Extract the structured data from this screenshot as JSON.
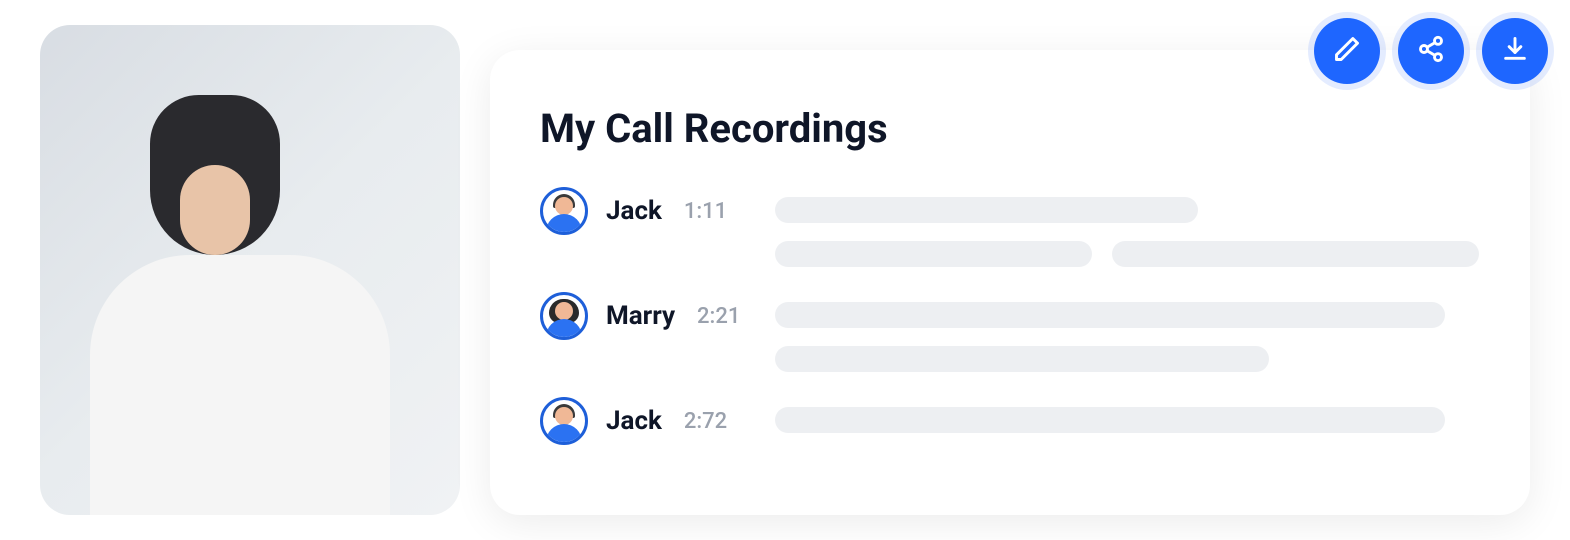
{
  "card": {
    "title": "My Call Recordings"
  },
  "actions": {
    "edit": "edit",
    "share": "share",
    "download": "download"
  },
  "recordings": [
    {
      "name": "Jack",
      "time": "1:11",
      "avatar": "male"
    },
    {
      "name": "Marry",
      "time": "2:21",
      "avatar": "female"
    },
    {
      "name": "Jack",
      "time": "2:72",
      "avatar": "male"
    }
  ]
}
